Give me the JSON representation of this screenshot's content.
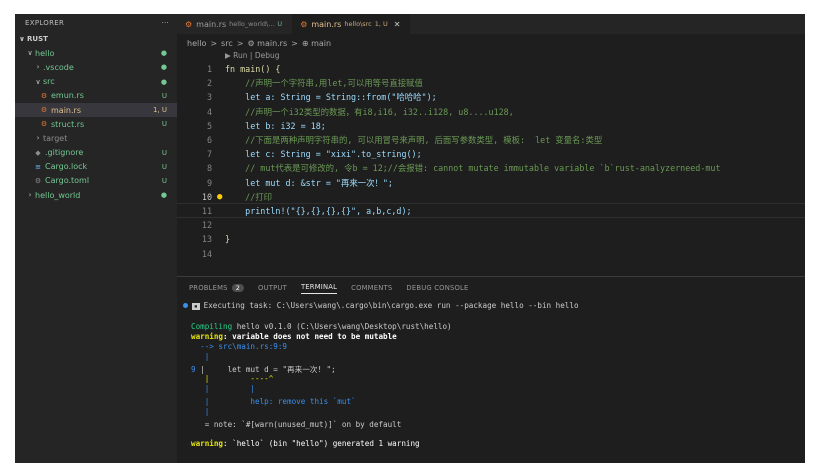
{
  "explorer": {
    "title": "EXPLORER",
    "more": "···",
    "root": "RUST",
    "items": [
      {
        "label": "hello",
        "badge": "●",
        "chev": "∨",
        "icon": ""
      },
      {
        "label": ".vscode",
        "badge": "●",
        "chev": "›",
        "icon": ""
      },
      {
        "label": "src",
        "badge": "●",
        "chev": "∨",
        "icon": ""
      },
      {
        "label": "emun.rs",
        "badge": "U",
        "chev": "",
        "icon": "⚙"
      },
      {
        "label": "main.rs",
        "badge": "1, U",
        "chev": "",
        "icon": "⚙"
      },
      {
        "label": "struct.rs",
        "badge": "U",
        "chev": "",
        "icon": "⚙"
      },
      {
        "label": "target",
        "badge": "",
        "chev": "›",
        "icon": ""
      },
      {
        "label": ".gitignore",
        "badge": "U",
        "chev": "",
        "icon": "◆"
      },
      {
        "label": "Cargo.lock",
        "badge": "U",
        "chev": "",
        "icon": "≡"
      },
      {
        "label": "Cargo.toml",
        "badge": "U",
        "chev": "",
        "icon": "⚙"
      },
      {
        "label": "hello_world",
        "badge": "●",
        "chev": "›",
        "icon": ""
      }
    ]
  },
  "tabs": [
    {
      "name": "main.rs",
      "path": "hello_world\\...",
      "status": "U"
    },
    {
      "name": "main.rs",
      "path": "hello\\src",
      "status": "1, U",
      "close": "✕"
    }
  ],
  "breadcrumb": [
    "hello",
    ">",
    "src",
    ">",
    "⚙ main.rs",
    ">",
    "⊕ main"
  ],
  "codelens": "▶ Run | Debug",
  "editor": {
    "line_numbers": [
      "1",
      "2",
      "3",
      "4",
      "5",
      "6",
      "7",
      "8",
      "9",
      "10",
      "11",
      "12",
      "13",
      "14"
    ],
    "current_line": "10",
    "lines": [
      "fn main() {",
      "    //声明一个字符串,用let,可以用等号直接赋值",
      "    let a: String = String::from(\"哈哈哈\");",
      "    //声明一个i32类型的数据，有i8,i16, i32..i128, u8....u128,",
      "    let b: i32 = 18;",
      "    //下面是两种声明字符串的, 可以用冒号来声明, 后面写参数类型, 模板:  let 变量名:类型",
      "    let c: String = \"xixi\".to_string();",
      "    // mut代表是可修改的, 令b = 12;//会报错: cannot mutate immutable variable `b`rust-analyzerneed-mut",
      "    let mut d: &str = \"再来一次！\";",
      "    //打印",
      "    println!(\"{},{},{},{}\", a,b,c,d);",
      "",
      "}",
      ""
    ]
  },
  "panel": {
    "tabs": [
      "PROBLEMS",
      "OUTPUT",
      "TERMINAL",
      "COMMENTS",
      "DEBUG CONSOLE"
    ],
    "problems_count": "2",
    "active_tab": "TERMINAL"
  },
  "terminal": {
    "task": "Executing task: C:\\Users\\wang\\.cargo\\bin\\cargo.exe run --package hello --bin hello",
    "compiling_word": "Compiling",
    "compiling_rest": " hello v0.1.0 (C:\\Users\\wang\\Desktop\\rust\\hello)",
    "warning_word": "warning",
    "warning_msg": ": variable does not need to be mutable",
    "location": "  --> src\\main.rs:9:9",
    "bar1": "   |",
    "code_ln": "9",
    "code_text": " |     let mut d = \"再来一次! \";",
    "caret": "   |         ----^",
    "bar2": "   |         |",
    "help": "   |         help: remove this `mut`",
    "bar3": "   |",
    "note": "   = note: `#[warn(unused_mut)]` on by default",
    "final_warning_word": "warning",
    "final_msg": ": `hello` (bin \"hello\") generated 1 warning"
  }
}
